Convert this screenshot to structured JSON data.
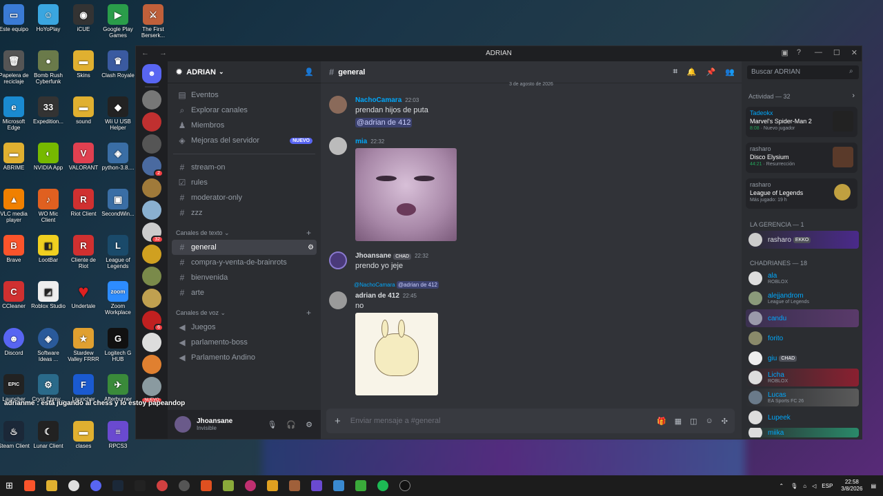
{
  "desktop": {
    "icons": [
      {
        "label": "Este equipo",
        "color": "#3a7bd5",
        "glyph": "▭"
      },
      {
        "label": "HoYoPlay",
        "color": "#3aa6e0",
        "glyph": "☺"
      },
      {
        "label": "iCUE",
        "color": "#222",
        "glyph": "◉"
      },
      {
        "label": "Google Play Games",
        "color": "#2a9d4a",
        "glyph": "▶"
      },
      {
        "label": "The First Berserk...",
        "color": "#c0603a",
        "glyph": "⚔"
      },
      {
        "label": "Papelera de reciclaje",
        "color": "#444",
        "glyph": "🗑"
      },
      {
        "label": "Bomb Rush Cyberfunk",
        "color": "#6a7a4a",
        "glyph": "●"
      },
      {
        "label": "Skins",
        "color": "#e0b030",
        "glyph": "▬"
      },
      {
        "label": "Clash Royale",
        "color": "#3a5aa0",
        "glyph": "♛"
      },
      {
        "label": "",
        "color": "transparent",
        "glyph": ""
      },
      {
        "label": "Microsoft Edge",
        "color": "#1a8ad0",
        "glyph": "e"
      },
      {
        "label": "Expedition...",
        "color": "#333",
        "glyph": "33"
      },
      {
        "label": "sound",
        "color": "#e0b030",
        "glyph": "▬"
      },
      {
        "label": "Wii U USB Helper",
        "color": "#222",
        "glyph": "◆"
      },
      {
        "label": "",
        "color": "transparent",
        "glyph": ""
      },
      {
        "label": "ABRIME",
        "color": "#e0b030",
        "glyph": "▬"
      },
      {
        "label": "NVIDIA App",
        "color": "#76b900",
        "glyph": "◐"
      },
      {
        "label": "VALORANT",
        "color": "#e04050",
        "glyph": "V"
      },
      {
        "label": "python-3.8....",
        "color": "#3a6ea5",
        "glyph": "🐍"
      },
      {
        "label": "",
        "color": "transparent",
        "glyph": ""
      },
      {
        "label": "VLC media player",
        "color": "#f08000",
        "glyph": "▲"
      },
      {
        "label": "WO Mic Client",
        "color": "#e06020",
        "glyph": "🎤"
      },
      {
        "label": "Riot Client",
        "color": "#d03030",
        "glyph": "R"
      },
      {
        "label": "SecondWin...",
        "color": "#3a6ea5",
        "glyph": "▣"
      },
      {
        "label": "",
        "color": "transparent",
        "glyph": ""
      },
      {
        "label": "Brave",
        "color": "#fb542b",
        "glyph": "🦁"
      },
      {
        "label": "LootBar",
        "color": "#f0d020",
        "glyph": "◧"
      },
      {
        "label": "Cliente de Riot",
        "color": "#d03030",
        "glyph": "R"
      },
      {
        "label": "League of Legends",
        "color": "#1a4a6a",
        "glyph": "L"
      },
      {
        "label": "",
        "color": "transparent",
        "glyph": ""
      },
      {
        "label": "CCleaner",
        "color": "#d03030",
        "glyph": "C"
      },
      {
        "label": "Roblox Studio",
        "color": "#fff",
        "glyph": "◩"
      },
      {
        "label": "Undertale",
        "color": "#e02020",
        "glyph": "♥"
      },
      {
        "label": "Zoom Workplace",
        "color": "#2d8cff",
        "glyph": "zoom"
      },
      {
        "label": "",
        "color": "transparent",
        "glyph": ""
      },
      {
        "label": "Discord",
        "color": "#5865f2",
        "glyph": "☻"
      },
      {
        "label": "Software Ideas ...",
        "color": "#2a5a9a",
        "glyph": "◈"
      },
      {
        "label": "Stardew Valley FRRR",
        "color": "#e0a030",
        "glyph": "★"
      },
      {
        "label": "Logitech G HUB",
        "color": "#111",
        "glyph": "G"
      },
      {
        "label": "",
        "color": "transparent",
        "glyph": ""
      },
      {
        "label": "Launcher",
        "color": "#222",
        "glyph": "EPIC"
      },
      {
        "label": "Cryst Epmy...",
        "color": "#2a6a8a",
        "glyph": "⚙"
      },
      {
        "label": "Launcher",
        "color": "#1a5ad0",
        "glyph": "F"
      },
      {
        "label": "Afterburner",
        "color": "#3a8a3a",
        "glyph": "✈"
      },
      {
        "label": "",
        "color": "transparent",
        "glyph": ""
      },
      {
        "label": "Steam Client",
        "color": "#1b2838",
        "glyph": "♨"
      },
      {
        "label": "Lunar Client",
        "color": "#222",
        "glyph": "☾"
      },
      {
        "label": "clases",
        "color": "#e0b030",
        "glyph": "▬"
      },
      {
        "label": "RPCS3",
        "color": "#6a4ad0",
        "glyph": "≡"
      }
    ]
  },
  "overlay_text": "adrianme : está jugando al chess y lo estoy papeandop",
  "window": {
    "title": "ADRIAN",
    "nav": "← →",
    "controls": [
      "—",
      "☐",
      "✕"
    ]
  },
  "servers": {
    "badges": {
      "s3": "2",
      "s8": "32",
      "s13": "6"
    },
    "nuevo": "NUEVO"
  },
  "channels": {
    "server_name": "ADRIAN",
    "top": [
      {
        "icon": "📅",
        "label": "Eventos"
      },
      {
        "icon": "⌕",
        "label": "Explorar canales"
      },
      {
        "icon": "👥",
        "label": "Miembros"
      },
      {
        "icon": "⛨",
        "label": "Mejoras del servidor",
        "badge": "NUEVO"
      }
    ],
    "uncat": [
      {
        "icon": "#",
        "label": "stream-on"
      },
      {
        "icon": "☑",
        "label": "rules"
      },
      {
        "icon": "#",
        "label": "moderator-only"
      },
      {
        "icon": "#",
        "label": "zzz"
      }
    ],
    "text_category": "Canales de texto",
    "text": [
      {
        "icon": "#",
        "label": "general"
      },
      {
        "icon": "#",
        "label": "compra-y-venta-de-brainrots"
      },
      {
        "icon": "#",
        "label": "bienvenida"
      },
      {
        "icon": "#",
        "label": "arte"
      }
    ],
    "voice_category": "Canales de voz",
    "voice": [
      {
        "icon": "🔊",
        "label": "Juegos"
      },
      {
        "icon": "🔊",
        "label": "parlamento-boss"
      },
      {
        "icon": "🔊",
        "label": "Parlamento Andino"
      }
    ],
    "user": {
      "name": "Jhoansane",
      "status": "Invisible"
    }
  },
  "chat": {
    "channel": "general",
    "date": "3 de agosto de 2026",
    "messages": [
      {
        "user": "NachoCamara",
        "time": "22:03",
        "lines": [
          "prendan hijos de puta"
        ],
        "mention": "@adrian de 412"
      },
      {
        "user": "mia",
        "time": "22:32",
        "image": "cat-image"
      },
      {
        "user": "Jhoansane",
        "tag": "CHAD",
        "time": "22:32",
        "lines": [
          "prendo yo jeje"
        ]
      },
      {
        "reply_user": "@NachoCamara",
        "reply_mention": "@adrian de 412",
        "user": "adrian de 412",
        "time": "22:45",
        "lines": [
          "no"
        ],
        "image": "bunny-image"
      }
    ],
    "placeholder": "Enviar mensaje a #general"
  },
  "members": {
    "search_placeholder": "Buscar ADRIAN",
    "activity_header": "Actividad — 32",
    "activities": [
      {
        "user": "Tadeokx",
        "game": "Marvel's Spider-Man 2",
        "time": "8:08",
        "note": "Nuevo jugador"
      },
      {
        "user": "rasharo",
        "game": "Disco Elysium",
        "time": "44:21",
        "note": "Resurrección"
      },
      {
        "user": "rasharo",
        "game": "League of Legends",
        "time": "",
        "note": "Más jugado: 19 h"
      }
    ],
    "gerencia_header": "LA GERENCIA — 1",
    "gerencia": [
      {
        "name": "rasharo",
        "tag": "EKKO"
      }
    ],
    "chadrianes_header": "CHADRIANES — 18",
    "list": [
      {
        "name": "ala",
        "sub": "ROBLOX"
      },
      {
        "name": "alejjandrom",
        "sub": "League of Legends"
      },
      {
        "name": "candu",
        "sub": ""
      },
      {
        "name": "forito",
        "sub": ""
      },
      {
        "name": "giu",
        "sub": "",
        "tag": "CHAD"
      },
      {
        "name": "Licha",
        "sub": "ROBLOX"
      },
      {
        "name": "Lucas",
        "sub": "EA Sports FC 26"
      },
      {
        "name": "Lupeek",
        "sub": ""
      },
      {
        "name": "miika",
        "sub": ""
      }
    ]
  },
  "taskbar": {
    "lang": "ESP",
    "time": "22:58",
    "date": "3/8/2026"
  }
}
